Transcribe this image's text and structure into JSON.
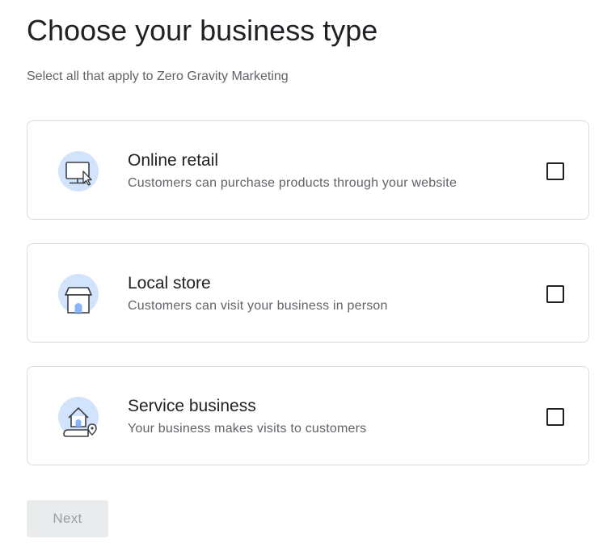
{
  "page": {
    "title": "Choose your business type",
    "subtitle": "Select all that apply to Zero Gravity Marketing"
  },
  "options": [
    {
      "title": "Online retail",
      "description": "Customers can purchase products through your website",
      "icon": "computer-cursor-icon",
      "checked": false
    },
    {
      "title": "Local store",
      "description": "Customers can visit your business in person",
      "icon": "storefront-icon",
      "checked": false
    },
    {
      "title": "Service business",
      "description": "Your business makes visits to customers",
      "icon": "house-location-icon",
      "checked": false
    }
  ],
  "actions": {
    "next_label": "Next",
    "next_enabled": false
  },
  "colors": {
    "icon_circle": "#d2e3fc",
    "icon_accent": "#aecbfa",
    "card_border": "#dadce0",
    "button_disabled_bg": "#eaebec",
    "button_disabled_text": "#9aa0a6"
  }
}
